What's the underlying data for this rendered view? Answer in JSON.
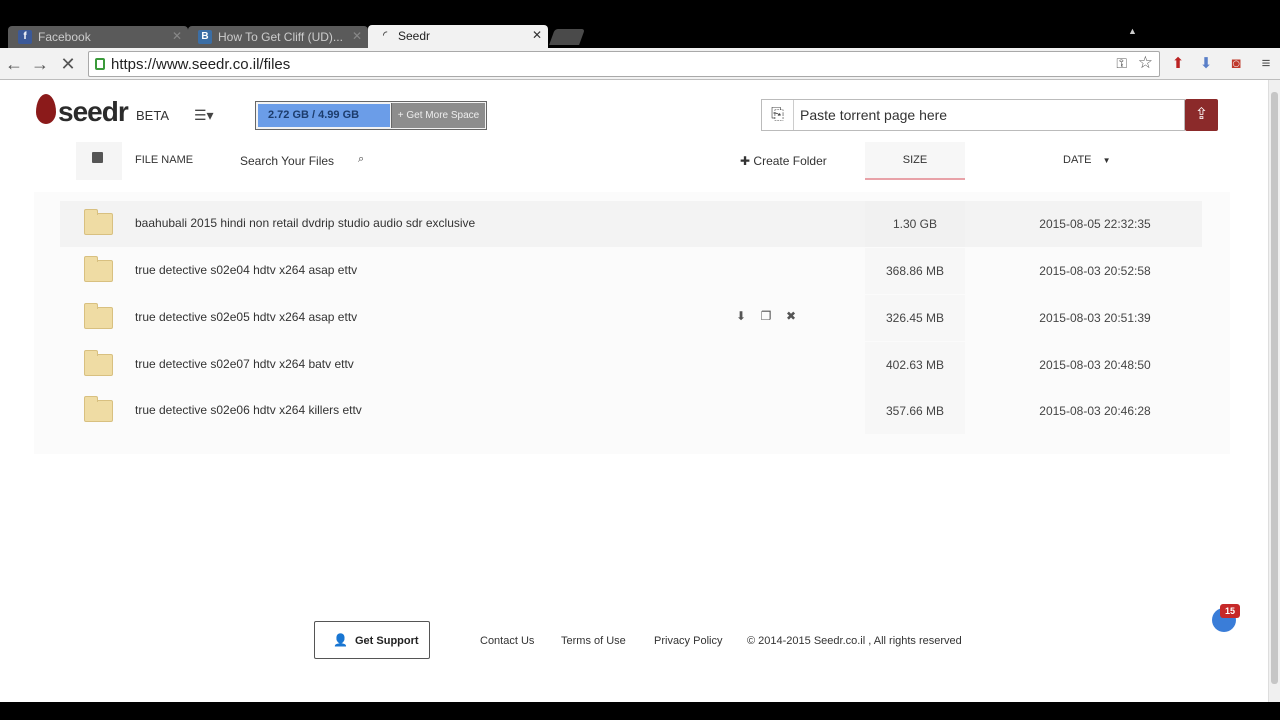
{
  "browser": {
    "tabs": [
      {
        "title": "Facebook",
        "favicon": "f",
        "favicon_color": "#3b5998"
      },
      {
        "title": "How To Get Cliff (UD)...",
        "favicon": "B",
        "favicon_color": "#3b6ea5"
      },
      {
        "title": "Seedr",
        "favicon": "seedr-loading",
        "favicon_color": "#f2f2f2"
      }
    ],
    "url": "https://www.seedr.co.il/files",
    "notification_count": "15"
  },
  "header": {
    "logo_text": "seedr",
    "beta_label": "BETA",
    "storage_text": "2.72 GB / 4.99 GB",
    "storage_used_fraction": 0.545,
    "get_more_label": "+ Get More Space",
    "torrent_placeholder": "Paste torrent page here",
    "brand_color": "#8b2a2a"
  },
  "columns": {
    "file_name": "FILE NAME",
    "search_placeholder": "Search Your Files",
    "create_folder": "Create Folder",
    "size": "SIZE",
    "date": "DATE"
  },
  "files": [
    {
      "name": "baahubali 2015 hindi non retail dvdrip studio audio sdr exclusive",
      "size": "1.30 GB",
      "date": "2015-08-05 22:32:35"
    },
    {
      "name": "true detective s02e04 hdtv x264 asap ettv",
      "size": "368.86 MB",
      "date": "2015-08-03 20:52:58"
    },
    {
      "name": "true detective s02e05 hdtv x264 asap ettv",
      "size": "326.45 MB",
      "date": "2015-08-03 20:51:39"
    },
    {
      "name": "true detective s02e07 hdtv x264 batv ettv",
      "size": "402.63 MB",
      "date": "2015-08-03 20:48:50"
    },
    {
      "name": "true detective s02e06 hdtv x264 killers ettv",
      "size": "357.66 MB",
      "date": "2015-08-03 20:46:28"
    }
  ],
  "footer": {
    "support_label": "Get Support",
    "contact": "Contact Us",
    "terms": "Terms of Use",
    "privacy": "Privacy Policy",
    "copyright": "© 2014-2015 Seedr.co.il , All rights reserved"
  }
}
